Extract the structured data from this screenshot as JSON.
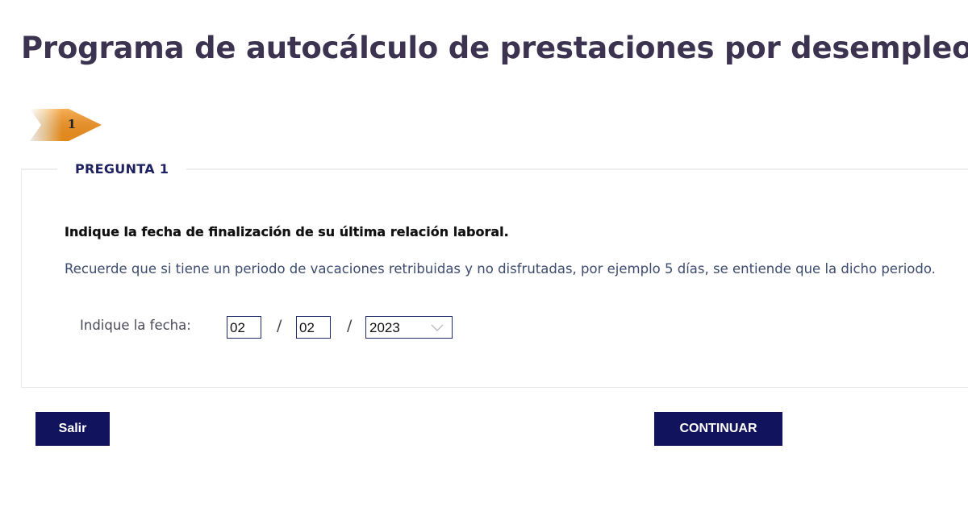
{
  "header": {
    "title": "Programa de autocálculo de prestaciones por desempleo"
  },
  "steps": {
    "current_label": "1",
    "colors": {
      "arrow": "#f7941d",
      "arrow_light": "#ffffff"
    }
  },
  "question": {
    "legend": "PREGUNTA 1",
    "text": "Indique la fecha de finalización de su última relación laboral.",
    "note": "Recuerde que si tiene un periodo de vacaciones retribuidas y no disfrutadas, por ejemplo 5 días, se entiende que la dicho periodo."
  },
  "date_form": {
    "label": "Indique la fecha:",
    "separator": "/",
    "day": "02",
    "month": "02",
    "year": "2023",
    "year_icon": "chevron-down-icon"
  },
  "actions": {
    "exit_label": "Salir",
    "continue_label": "CONTINUAR",
    "button_color": "#11135c"
  }
}
